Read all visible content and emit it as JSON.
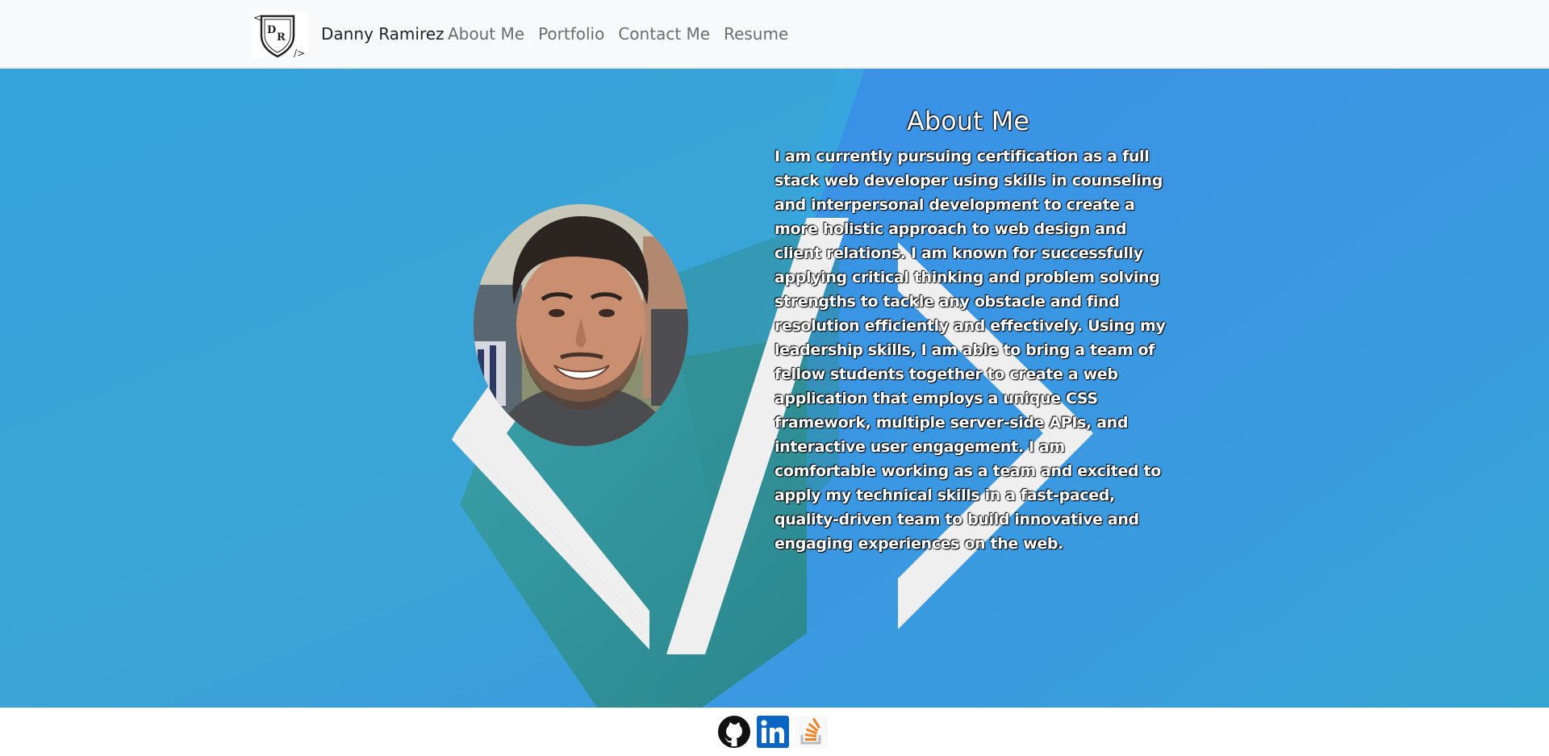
{
  "navbar": {
    "brand_name": "Danny Ramirez",
    "logo_letters": "DR",
    "links": [
      {
        "label": "About Me"
      },
      {
        "label": "Portfolio"
      },
      {
        "label": "Contact Me"
      },
      {
        "label": "Resume"
      }
    ]
  },
  "about": {
    "title": "About Me",
    "text": "I am currently pursuing certification as a full stack web developer using skills in counseling and interpersonal development to create a more holistic approach to web design and client relations. I am known for successfully applying critical thinking and problem solving strengths to tackle any obstacle and find resolution efficiently and effectively. Using my leadership skills, I am able to bring a team of fellow students together to create a web application that employs a unique CSS framework, multiple server-side APIs, and interactive user engagement. I am comfortable working as a team and excited to apply my technical skills in a fast-paced, quality-driven team to build innovative and engaging experiences on the web."
  },
  "footer": {
    "icons": [
      "github-icon",
      "linkedin-icon",
      "stackoverflow-icon"
    ]
  },
  "colors": {
    "hero_blue": "#3a9fd8",
    "hero_light_blue": "#2fa4e7",
    "hero_teal": "#2e8b8e",
    "code_symbol": "#efefef",
    "navbar_bg": "#f8f9fa",
    "linkedin_blue": "#0a66c2",
    "stackoverflow_orange": "#f48024"
  }
}
